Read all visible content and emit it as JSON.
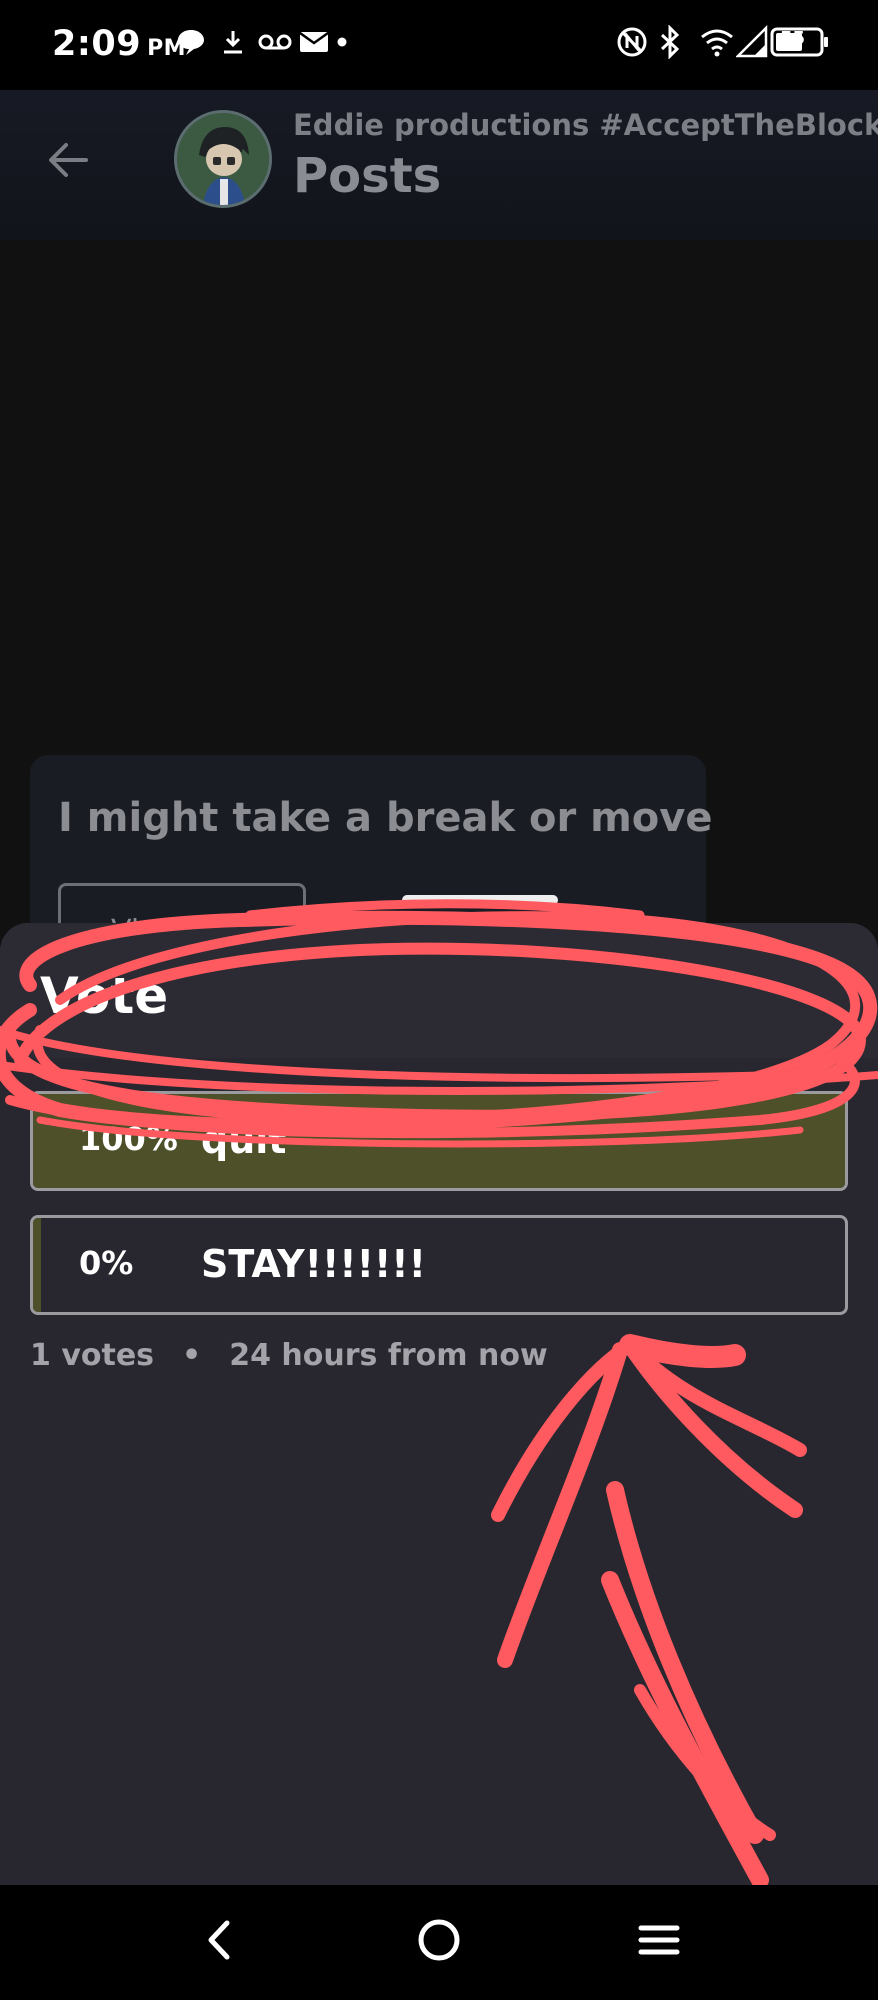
{
  "status_bar": {
    "time": "2:09",
    "ampm": "PM",
    "battery": "55"
  },
  "app_bar": {
    "subtitle": "Eddie productions #AcceptTheBlock's",
    "title": "Posts"
  },
  "post": {
    "text": "I might take a break or move",
    "view_button_label": "View"
  },
  "poll_sheet": {
    "title": "Vote",
    "options": [
      {
        "percent_label": "100%",
        "label": "quit",
        "fraction": 1.0
      },
      {
        "percent_label": "0%",
        "label": "STAY!!!!!!!",
        "fraction": 0.0
      }
    ],
    "votes": "1 votes",
    "separator": "•",
    "ends": "24 hours from now"
  },
  "colors": {
    "sheet_bg": "#28272f",
    "fill": "#4d5028",
    "annotation": "#ff5a5f"
  },
  "icons": [
    "back-arrow-icon",
    "chat-icon",
    "download-icon",
    "voicemail-icon",
    "mail-icon",
    "nfc-icon",
    "bluetooth-icon",
    "wifi-icon",
    "signal-icon",
    "battery-icon",
    "nav-back-icon",
    "nav-home-icon",
    "nav-menu-icon"
  ]
}
